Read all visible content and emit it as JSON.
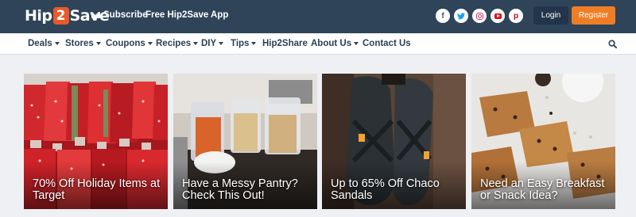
{
  "header": {
    "logo_text_1": "Hip",
    "logo_text_2": "2",
    "logo_text_3": "Save",
    "subscribe_label": "Subscribe",
    "app_label": "Free Hip2Save App",
    "social": [
      {
        "name": "facebook",
        "glyph": "f"
      },
      {
        "name": "twitter",
        "glyph": "t"
      },
      {
        "name": "instagram",
        "glyph": ""
      },
      {
        "name": "youtube",
        "glyph": ""
      },
      {
        "name": "pinterest",
        "glyph": "p"
      }
    ],
    "login_label": "Login",
    "register_label": "Register",
    "accent_color": "#ef7d26",
    "bar_color": "#2f4459"
  },
  "nav": {
    "items": [
      {
        "label": "Deals",
        "dropdown": true
      },
      {
        "label": "Stores",
        "dropdown": true
      },
      {
        "label": "Coupons",
        "dropdown": true
      },
      {
        "label": "Recipes",
        "dropdown": true
      },
      {
        "label": "DIY",
        "dropdown": true
      },
      {
        "label": "Tips",
        "dropdown": true
      },
      {
        "label": "Hip2Share",
        "dropdown": false
      },
      {
        "label": "About Us",
        "dropdown": true
      },
      {
        "label": "Contact Us",
        "dropdown": false
      }
    ]
  },
  "cards": [
    {
      "title": "70% Off Holiday Items at Target"
    },
    {
      "title": "Have a Messy Pantry? Check This Out!"
    },
    {
      "title": "Up to 65% Off Chaco Sandals"
    },
    {
      "title": "Need an Easy Breakfast or Snack Idea?"
    }
  ]
}
